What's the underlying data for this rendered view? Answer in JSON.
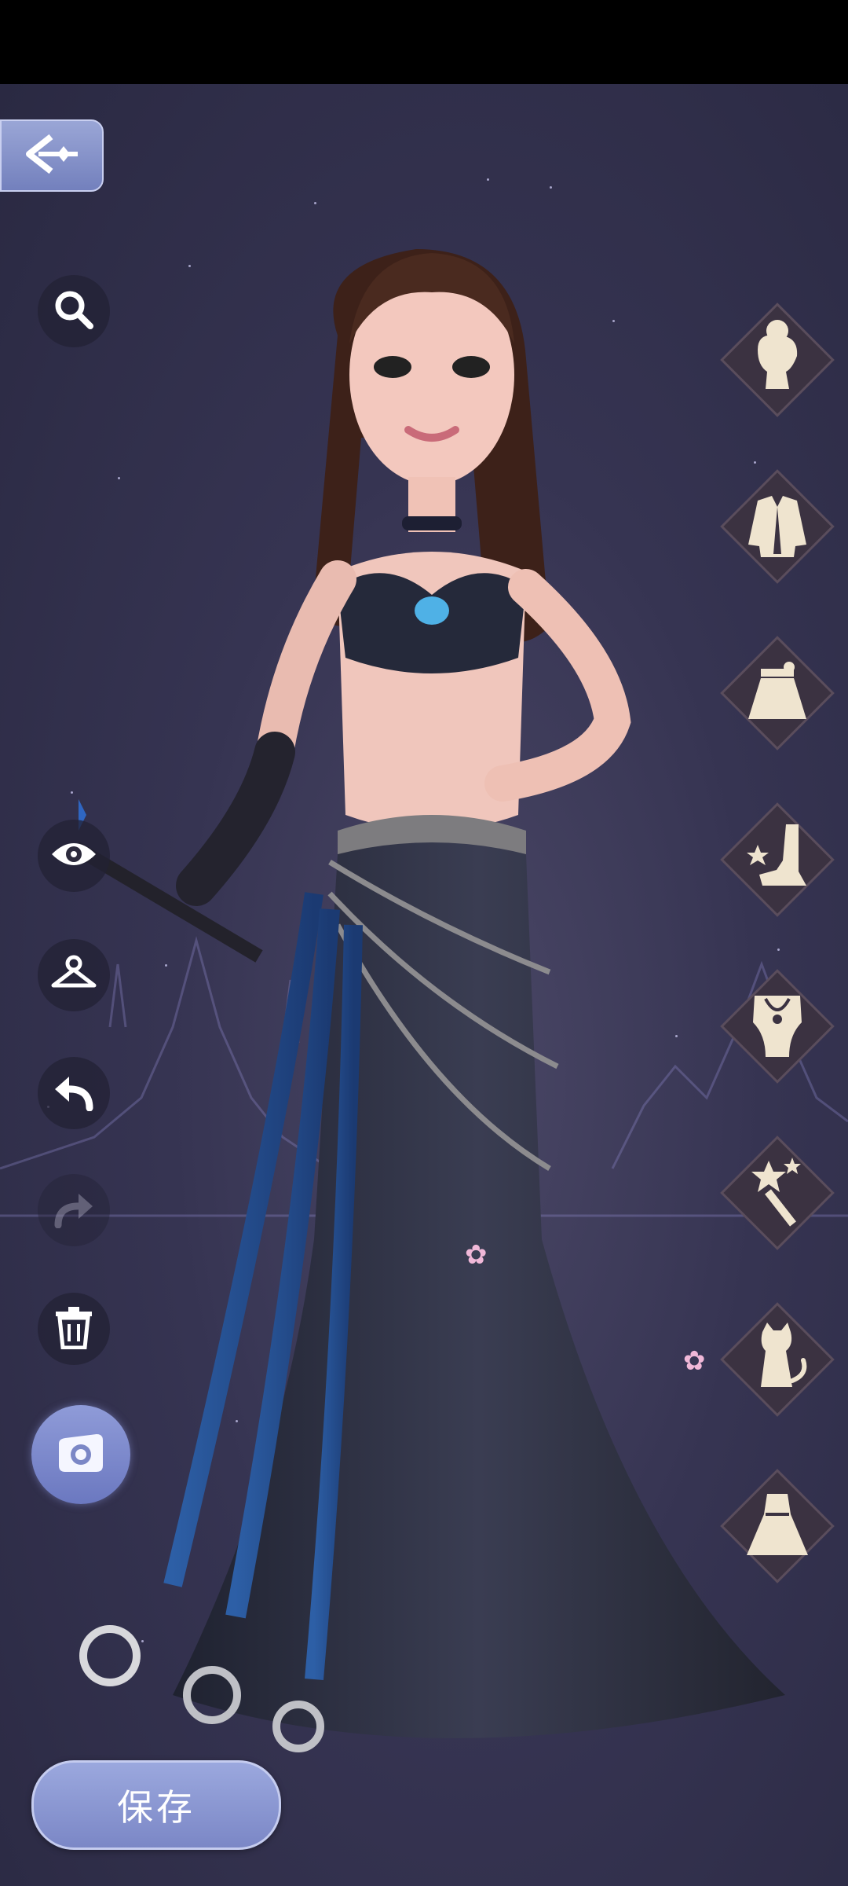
{
  "toolbar": {
    "back_icon": "back-arrow-icon",
    "zoom_icon": "magnifier-icon",
    "view_icon": "eye-icon",
    "wardrobe_icon": "hanger-icon",
    "undo_icon": "undo-icon",
    "redo_icon": "redo-icon",
    "delete_icon": "trash-icon",
    "capture_icon": "camera-icon"
  },
  "categories": [
    {
      "name": "hairstyle",
      "icon": "hair-icon"
    },
    {
      "name": "top",
      "icon": "jacket-icon"
    },
    {
      "name": "bottom",
      "icon": "skirt-icon"
    },
    {
      "name": "shoes",
      "icon": "boot-icon"
    },
    {
      "name": "accessories",
      "icon": "necklace-icon"
    },
    {
      "name": "handheld",
      "icon": "wand-icon"
    },
    {
      "name": "pet",
      "icon": "cat-icon"
    },
    {
      "name": "dress",
      "icon": "dress-icon"
    }
  ],
  "footer": {
    "save_label": "保存"
  },
  "colors": {
    "accent": "#7d88c8",
    "category_bg": "#3b3241",
    "category_icon": "#efe4cf"
  }
}
